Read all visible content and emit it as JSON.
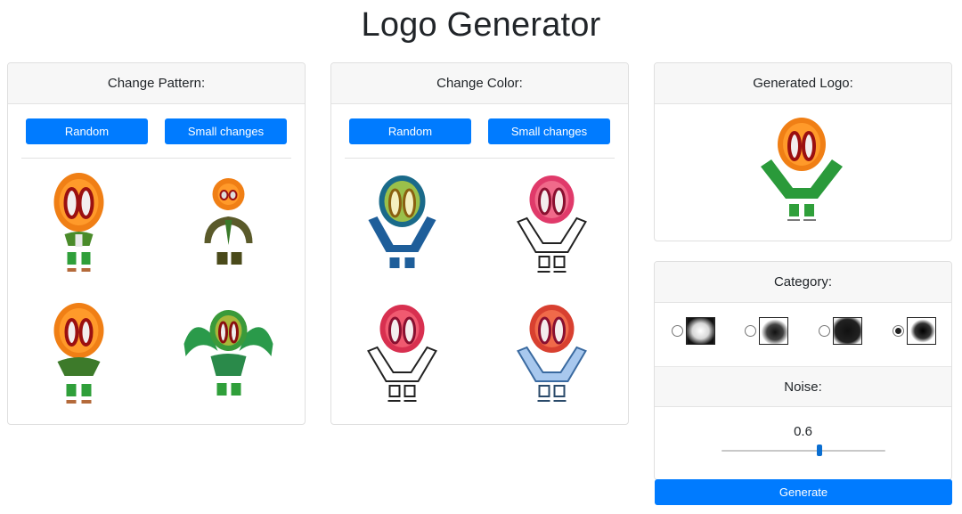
{
  "page": {
    "title": "Logo Generator"
  },
  "pattern": {
    "header": "Change Pattern:",
    "random_label": "Random",
    "small_label": "Small changes"
  },
  "color": {
    "header": "Change Color:",
    "random_label": "Random",
    "small_label": "Small changes"
  },
  "generated": {
    "header": "Generated Logo:"
  },
  "category": {
    "header": "Category:",
    "options": [
      "soft-square",
      "round-blob",
      "dark-circle",
      "dark-blob"
    ],
    "selected_index": 3
  },
  "noise": {
    "header": "Noise:",
    "value": "0.6",
    "fraction": 0.6
  },
  "generate_label": "Generate",
  "colors": {
    "accent": "#007bff",
    "header_bg": "#f7f7f7",
    "border": "#dfdfdf"
  }
}
